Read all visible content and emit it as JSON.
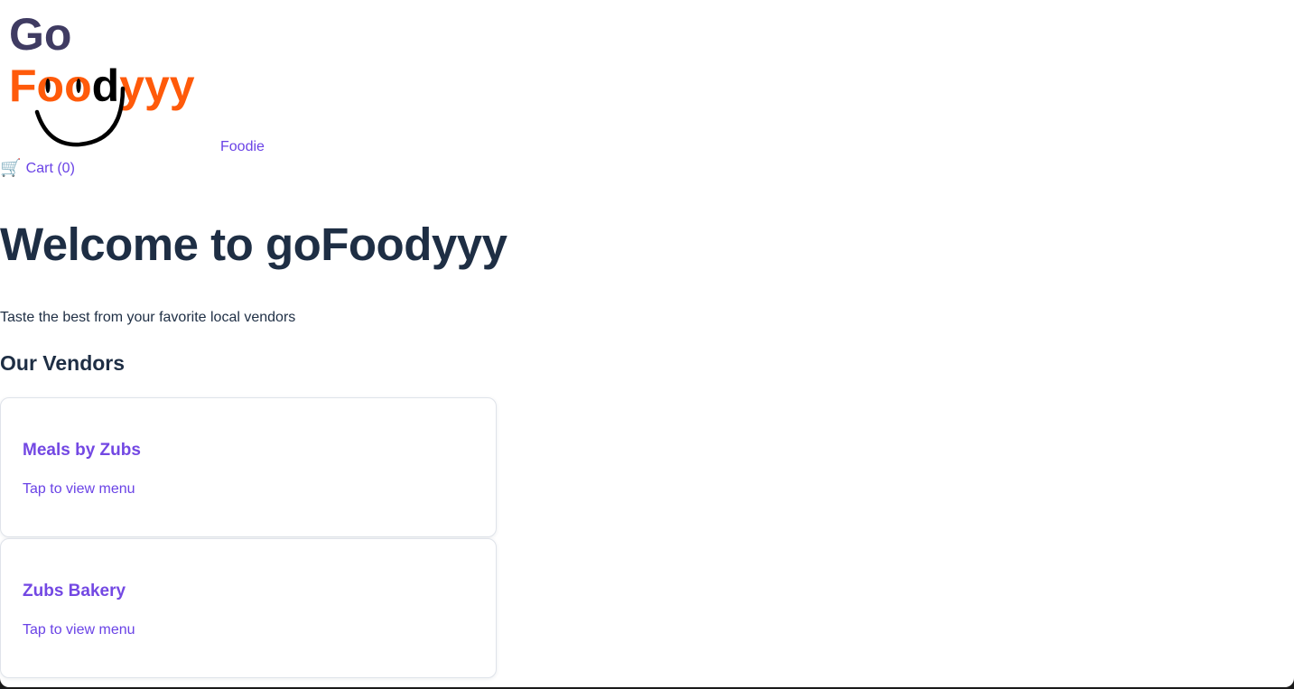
{
  "logo": {
    "line1": "Go",
    "line2_prefix": "F",
    "line2_oo": "oo",
    "line2_d": "d",
    "line2_suffix": "yyy",
    "colors": {
      "go": "#3f3b62",
      "foodyyy": "#ff5a0a",
      "smile": "#000000"
    }
  },
  "nav": {
    "foodie_label": "Foodie",
    "cart_icon": "shopping-cart-icon",
    "cart_glyph": "🛒",
    "cart_label": "Cart (0)"
  },
  "hero": {
    "title": "Welcome to goFoodyyy",
    "subtitle": "Taste the best from your favorite local vendors"
  },
  "vendors_section": {
    "title": "Our Vendors",
    "vendors": [
      {
        "name": "Meals by Zubs",
        "cta": "Tap to view menu"
      },
      {
        "name": "Zubs Bakery",
        "cta": "Tap to view menu"
      }
    ]
  },
  "colors": {
    "accent": "#6a43e6",
    "heading": "#1e2e44",
    "card_border": "#dfe3ea"
  }
}
